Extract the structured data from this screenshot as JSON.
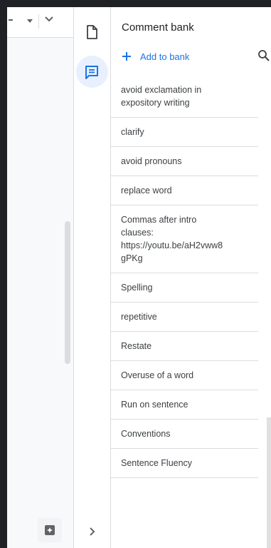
{
  "panel": {
    "title": "Comment bank",
    "add_label": "Add to bank"
  },
  "comments": [
    "avoid exclamation in\nexpository writing",
    "clarify",
    "avoid pronouns",
    "replace word",
    "Commas after intro\nclauses:\nhttps://youtu.be/aH2vww8\ngPKg",
    "Spelling",
    "repetitive",
    "Restate",
    "Overuse of a word",
    "Run on sentence",
    "Conventions",
    "Sentence Fluency"
  ],
  "icons": {
    "doc_tab": "document-icon",
    "comment_bank": "comment-icon",
    "add": "plus-icon",
    "search": "search-icon",
    "expand": "chevron-right-icon",
    "explore": "explore-icon"
  },
  "colors": {
    "accent": "#1a73e8",
    "active_bg": "#e8f0fe",
    "divider": "#dadce0"
  }
}
